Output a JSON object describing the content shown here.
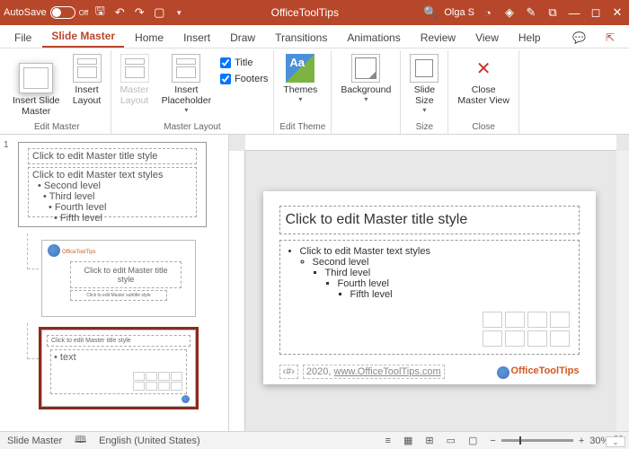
{
  "titlebar": {
    "autosave": "AutoSave",
    "autosave_state": "Off",
    "doc": "OfficeToolTips",
    "user": "Olga S"
  },
  "tabs": {
    "file": "File",
    "slide_master": "Slide Master",
    "home": "Home",
    "insert": "Insert",
    "draw": "Draw",
    "transitions": "Transitions",
    "animations": "Animations",
    "review": "Review",
    "view": "View",
    "help": "Help"
  },
  "ribbon": {
    "insert_slide_master": "Insert Slide\nMaster",
    "insert_layout": "Insert\nLayout",
    "master_layout": "Master\nLayout",
    "insert_placeholder": "Insert\nPlaceholder",
    "chk_title": "Title",
    "chk_footers": "Footers",
    "themes": "Themes",
    "background": "Background",
    "slide_size": "Slide\nSize",
    "close_master": "Close\nMaster View",
    "g_edit_master": "Edit Master",
    "g_master_layout": "Master Layout",
    "g_edit_theme": "Edit Theme",
    "g_size": "Size",
    "g_close": "Close"
  },
  "thumbs": {
    "num": "1",
    "master_title": "Click to edit Master title style",
    "master_body": "Click to edit Master text styles",
    "l2": "Second level",
    "l3": "Third level",
    "l4": "Fourth level",
    "l5": "Fifth level",
    "layout2_title": "Click to edit Master title style",
    "layout2_sub": "Click to edit Master subtitle style",
    "layout3_title": "Click to edit Master title style"
  },
  "slide": {
    "title": "Click to edit Master title style",
    "b1": "Click to edit Master text styles",
    "b2": "Second level",
    "b3": "Third level",
    "b4": "Fourth level",
    "b5": "Fifth level",
    "footer_date": "2020,",
    "footer_link": "www.OfficeToolTips.com",
    "logo": "OfficeToolTips",
    "pgnum": "‹#›"
  },
  "status": {
    "mode": "Slide Master",
    "lang": "English (United States)",
    "zoom": "30%"
  }
}
